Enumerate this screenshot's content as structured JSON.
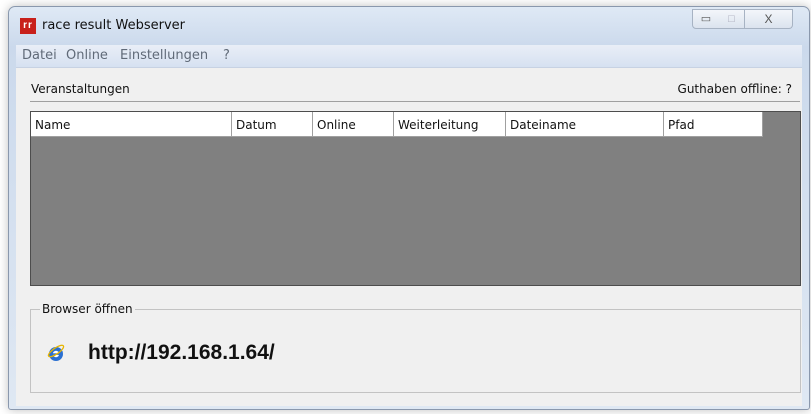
{
  "window": {
    "title": "race result Webserver",
    "logo_text": "rr",
    "controls": {
      "minimize": "▭",
      "maximize": "□",
      "close": "X"
    }
  },
  "menu": {
    "items": [
      {
        "label": "Datei"
      },
      {
        "label": "Online"
      },
      {
        "label": "Einstellungen"
      },
      {
        "label": "?"
      }
    ]
  },
  "events": {
    "section_label": "Veranstaltungen",
    "credit_label": "Guthaben offline: ?",
    "columns": [
      "Name",
      "Datum",
      "Online",
      "Weiterleitung",
      "Dateiname",
      "Pfad"
    ],
    "rows": []
  },
  "browser": {
    "group_label": "Browser öffnen",
    "url": "http://192.168.1.64/",
    "icon": "internet-explorer-icon"
  },
  "colors": {
    "logo": "#c8201b",
    "table_background": "#808080",
    "ie_blue": "#2a6fd1"
  }
}
